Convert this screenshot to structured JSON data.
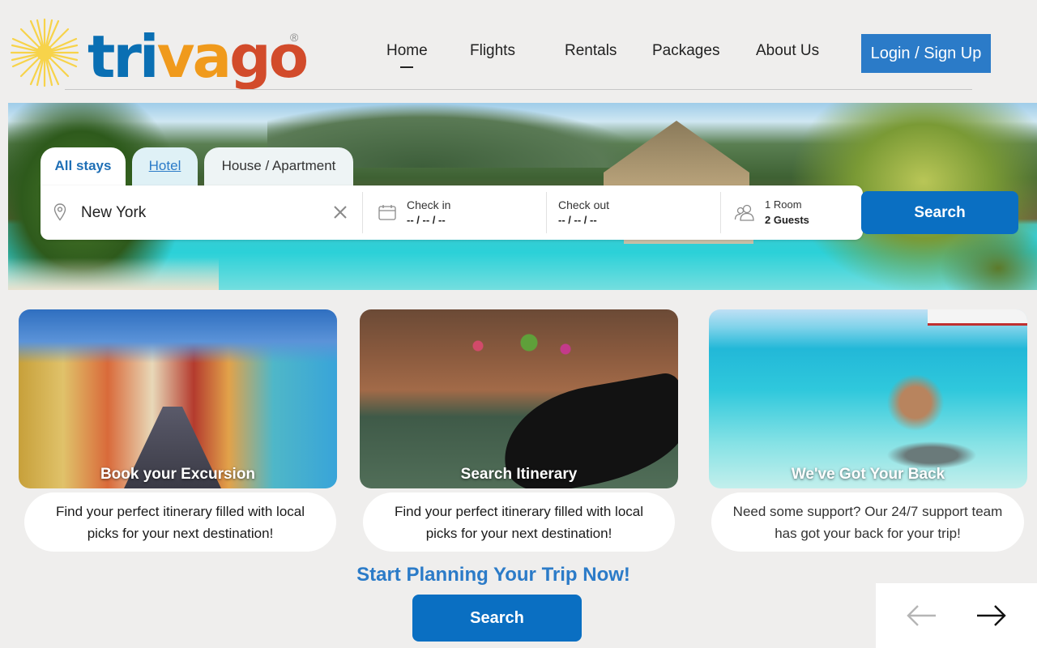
{
  "brand": {
    "logo_text_1": "tri",
    "logo_text_2": "va",
    "logo_text_3": "go",
    "registered_mark": "®",
    "colors": {
      "blue": "#0a6fb3",
      "orange": "#f09a1c",
      "red": "#d24b2b",
      "sun": "#f7d34a"
    }
  },
  "nav": {
    "items": [
      {
        "label": "Home",
        "active": true
      },
      {
        "label": "Flights"
      },
      {
        "label": "Rentals"
      },
      {
        "label": "Packages"
      },
      {
        "label": "About Us"
      }
    ],
    "login_label": "Login / Sign Up"
  },
  "search": {
    "tabs": [
      {
        "label": "All stays",
        "active": true
      },
      {
        "label": "Hotel"
      },
      {
        "label": "House / Apartment"
      }
    ],
    "destination": {
      "value": "New York",
      "icon": "map-pin-icon"
    },
    "check_in": {
      "label": "Check in",
      "value": "-- / -- / --"
    },
    "check_out": {
      "label": "Check out",
      "value": "-- / -- / --"
    },
    "rooms": {
      "rooms_label": "1 Room",
      "guests_label": "2 Guests"
    },
    "button_label": "Search"
  },
  "cards": [
    {
      "title": "Book your Excursion",
      "description": "Find your perfect itinerary filled with local picks for your next destination!"
    },
    {
      "title": "Search Itinerary",
      "description": "Find your perfect itinerary filled with local picks for your next destination!"
    },
    {
      "title": "We've Got Your Back",
      "description": "Need some support? Our 24/7 support team has got your back for your trip!"
    }
  ],
  "cta": {
    "heading": "Start Planning Your Trip Now!",
    "button_label": "Search"
  },
  "carousel": {
    "prev_icon": "arrow-left-icon",
    "next_icon": "arrow-right-icon"
  },
  "accent_color": "#0a6fc2"
}
